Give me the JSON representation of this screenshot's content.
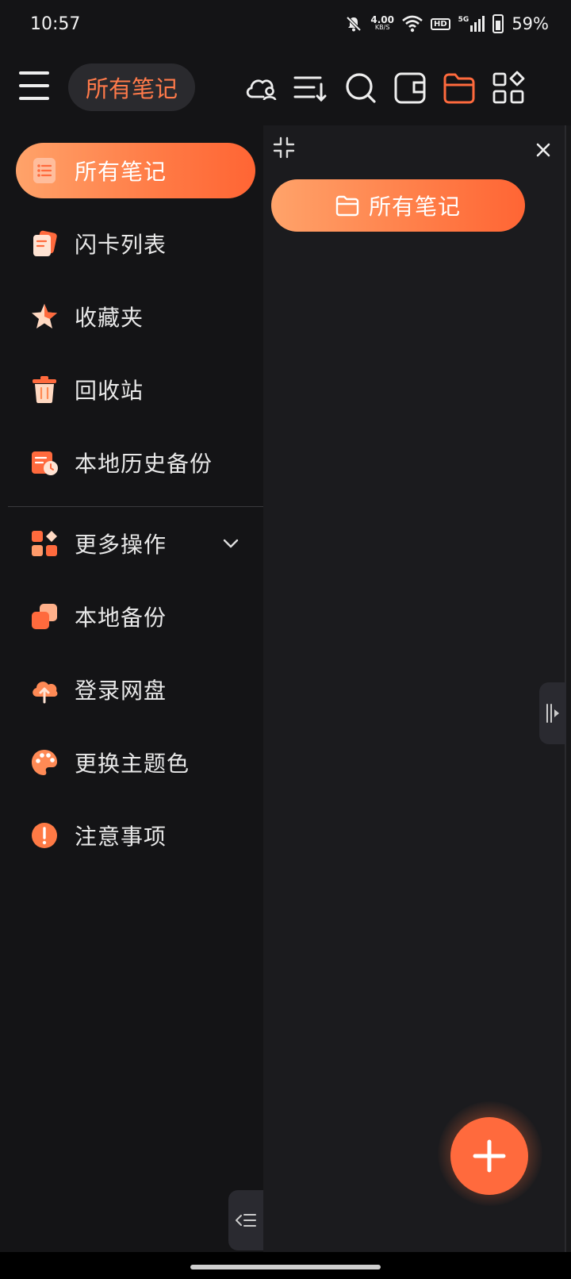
{
  "status_bar": {
    "time": "10:57",
    "net_speed_value": "4.00",
    "net_speed_unit": "KB/S",
    "hd": "HD",
    "signal": "5G",
    "battery": "59%"
  },
  "app_bar": {
    "title": "所有笔记",
    "icons": [
      "cloud-user-icon",
      "sort-icon",
      "search-icon",
      "wallet-icon",
      "folder-icon",
      "apps-icon"
    ],
    "accent": "#ff7a4a"
  },
  "sidebar": {
    "items": [
      {
        "label": "所有笔记",
        "icon": "notes-list-icon",
        "active": true
      },
      {
        "label": "闪卡列表",
        "icon": "flashcard-icon"
      },
      {
        "label": "收藏夹",
        "icon": "star-icon"
      },
      {
        "label": "回收站",
        "icon": "trash-icon"
      },
      {
        "label": "本地历史备份",
        "icon": "history-backup-icon"
      }
    ],
    "more": [
      {
        "label": "更多操作",
        "icon": "more-actions-icon"
      },
      {
        "label": "本地备份",
        "icon": "local-backup-icon"
      },
      {
        "label": "登录网盘",
        "icon": "cloud-upload-icon"
      },
      {
        "label": "更换主题色",
        "icon": "palette-icon"
      },
      {
        "label": "注意事项",
        "icon": "notice-icon"
      }
    ]
  },
  "panel": {
    "folder_label": "所有笔记"
  },
  "colors": {
    "accent": "#ff6a3d",
    "gradient_start": "#ffa36a",
    "background": "#18181a"
  }
}
